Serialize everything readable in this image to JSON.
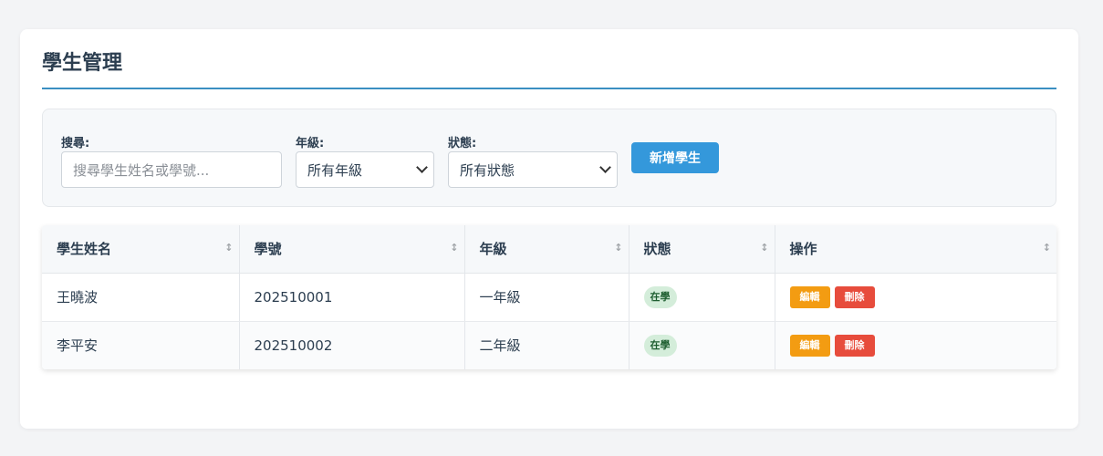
{
  "page": {
    "title": "學生管理"
  },
  "filters": {
    "search": {
      "label": "搜尋:",
      "placeholder": "搜尋學生姓名或學號..."
    },
    "grade": {
      "label": "年級:",
      "selected": "所有年級"
    },
    "status": {
      "label": "狀態:",
      "selected": "所有狀態"
    },
    "add_button": "新增學生"
  },
  "table": {
    "columns": [
      "學生姓名",
      "學號",
      "年級",
      "狀態",
      "操作"
    ],
    "sort_icon": "↕",
    "rows": [
      {
        "name": "王曉波",
        "id": "202510001",
        "grade": "一年級",
        "status": "在學",
        "edit": "編輯",
        "delete": "刪除"
      },
      {
        "name": "李平安",
        "id": "202510002",
        "grade": "二年級",
        "status": "在學",
        "edit": "編輯",
        "delete": "刪除"
      }
    ]
  },
  "colors": {
    "accent": "#3498db",
    "edit": "#f39c12",
    "delete": "#e74c3c",
    "status_bg": "#d4edda"
  }
}
